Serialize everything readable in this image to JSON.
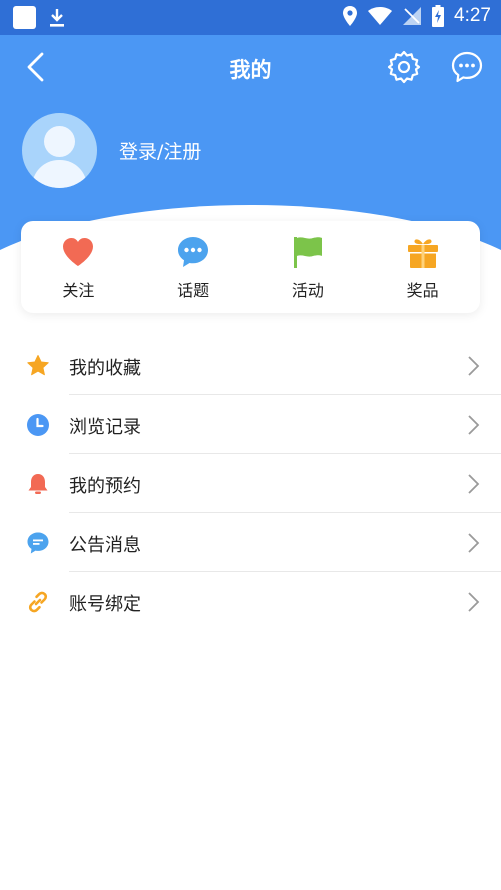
{
  "status_bar": {
    "time": "4:27"
  },
  "nav": {
    "title": "我的"
  },
  "profile": {
    "login_label": "登录/注册"
  },
  "quick_actions": [
    {
      "label": "关注",
      "icon": "heart-icon",
      "color": "#f26a54"
    },
    {
      "label": "话题",
      "icon": "chat-bubble-icon",
      "color": "#4ca3ee"
    },
    {
      "label": "活动",
      "icon": "flag-icon",
      "color": "#7cc44a"
    },
    {
      "label": "奖品",
      "icon": "gift-icon",
      "color": "#f6a623"
    }
  ],
  "menu": [
    {
      "label": "我的收藏",
      "icon": "star-icon",
      "color": "#f6a623"
    },
    {
      "label": " 浏览记录",
      "icon": "clock-icon",
      "color": "#4b97f4"
    },
    {
      "label": "我的预约",
      "icon": "bell-icon",
      "color": "#f26a54"
    },
    {
      "label": "公告消息",
      "icon": "message-icon",
      "color": "#4ca3ee"
    },
    {
      "label": "账号绑定",
      "icon": "link-icon",
      "color": "#f6a623"
    }
  ],
  "colors": {
    "header": "#4b97f4",
    "status_bar": "#2f6fd6"
  }
}
